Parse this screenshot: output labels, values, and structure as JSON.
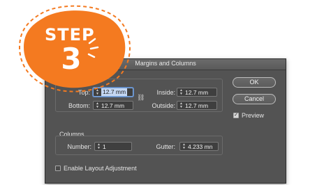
{
  "badge": {
    "word": "STEP",
    "number": "3",
    "color": "#f47a20"
  },
  "dialog": {
    "title": "Margins and Columns",
    "margins": {
      "top_label": "Top:",
      "top_value": "12.7 mm",
      "bottom_label": "Bottom:",
      "bottom_value": "12.7 mm",
      "inside_label": "Inside:",
      "inside_value": "12.7 mm",
      "outside_label": "Outside:",
      "outside_value": "12.7 mm"
    },
    "columns": {
      "heading": "Columns",
      "number_label": "Number:",
      "number_value": "1",
      "gutter_label": "Gutter:",
      "gutter_value": "4.233 mn"
    },
    "layout_adjustment_label": "Enable Layout Adjustment",
    "ok_label": "OK",
    "cancel_label": "Cancel",
    "preview_label": "Preview",
    "preview_checkmark": "✓",
    "link_icon_glyph": "⛓",
    "spinner_glyph": "▲▼"
  }
}
